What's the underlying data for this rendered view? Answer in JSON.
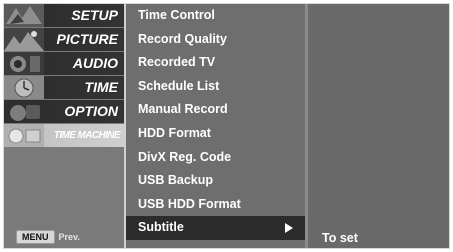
{
  "nav": {
    "items": [
      {
        "label": "SETUP",
        "icon": "setup-thumbnail"
      },
      {
        "label": "PICTURE",
        "icon": "picture-thumbnail"
      },
      {
        "label": "AUDIO",
        "icon": "audio-thumbnail"
      },
      {
        "label": "TIME",
        "icon": "time-thumbnail"
      },
      {
        "label": "OPTION",
        "icon": "option-thumbnail"
      },
      {
        "label": "TIME MACHINE",
        "icon": "time-machine-thumbnail",
        "selected": true
      }
    ]
  },
  "menu": {
    "options": [
      "Time Control",
      "Record Quality",
      "Recorded TV",
      "Schedule List",
      "Manual Record",
      "HDD Format",
      "DivX Reg. Code",
      "USB Backup",
      "USB HDD Format",
      "Subtitle"
    ],
    "selected_option": "Subtitle"
  },
  "submenu": {
    "option": "To set"
  },
  "footer": {
    "key": "MENU",
    "action": "Prev."
  },
  "colors": {
    "panel": "#6e6e6e",
    "selected_row": "#2c2c2c",
    "text": "#ffffff"
  }
}
